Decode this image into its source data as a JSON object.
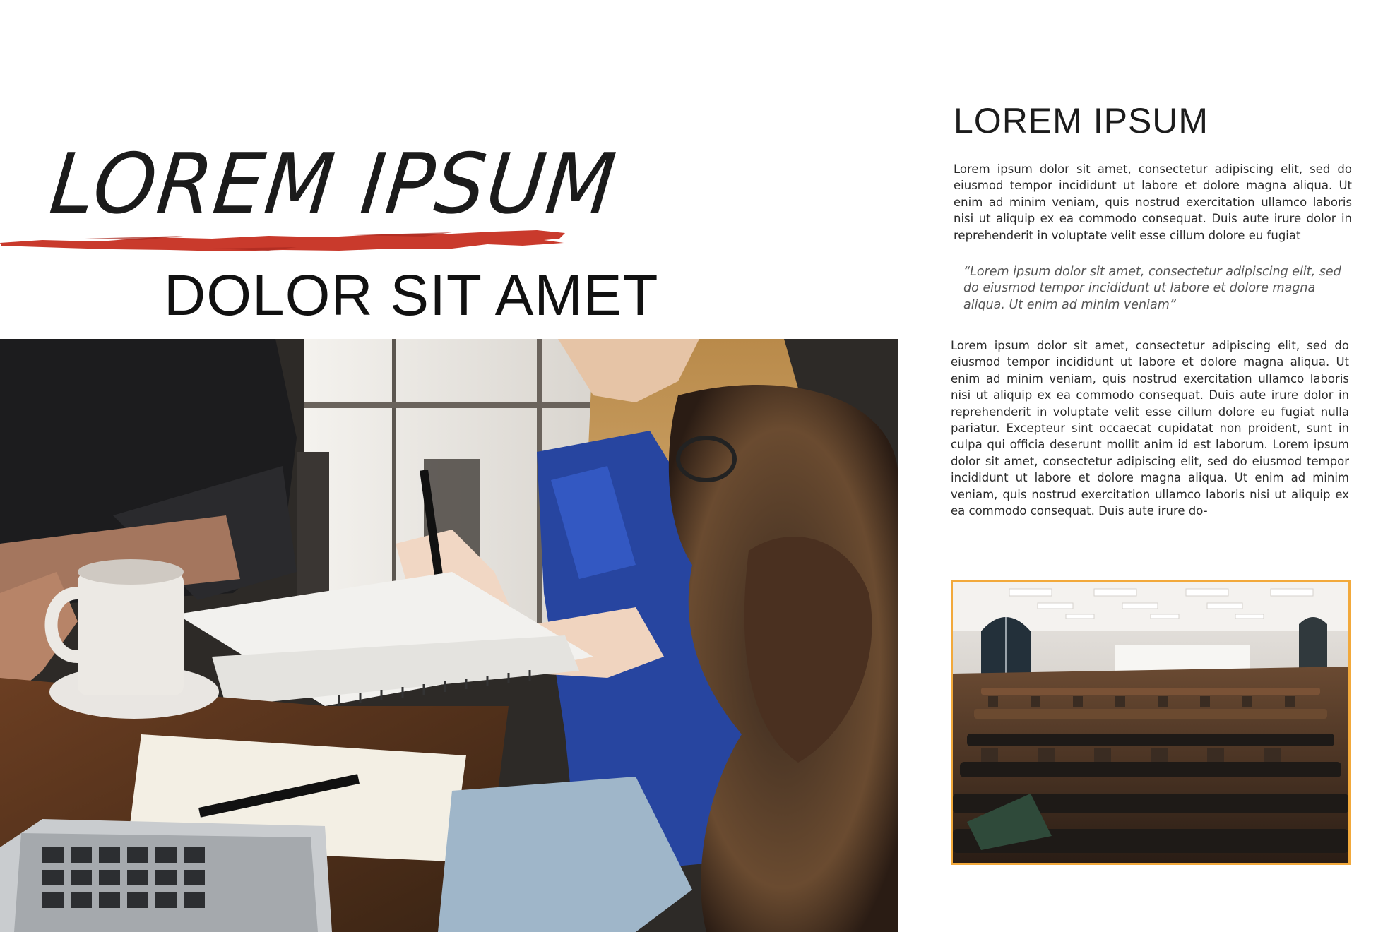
{
  "left_page": {
    "script_title": "LOREM IPSUM",
    "subtitle": "DOLOR SIT AMET",
    "accent_color": "#c93a2c",
    "photo_icon": "students-studying-photo"
  },
  "right_page": {
    "heading": "LOREM IPSUM",
    "paragraph_1": "Lorem ipsum dolor sit amet, consectetur adipiscing elit, sed do eiusmod tempor incididunt ut labore et dolore magna aliqua. Ut enim ad minim veniam, quis nostrud exercitation ullamco laboris nisi ut aliquip ex ea commodo consequat. Duis aute irure dolor in reprehenderit in voluptate velit esse cillum dolore eu fugiat",
    "quote": "“Lorem ipsum dolor sit amet, consectetur adipiscing elit, sed do eiusmod tempor incididunt ut labore et dolore magna aliqua. Ut enim ad minim veniam”",
    "paragraph_2": "Lorem ipsum dolor sit amet, consectetur adipiscing elit, sed do eiusmod tempor incididunt ut labore et dolore magna aliqua. Ut enim ad minim veniam, quis nostrud exercitation ullamco laboris nisi ut aliquip ex ea commodo consequat. Duis aute irure dolor in reprehenderit in voluptate velit esse cillum dolore eu fugiat nulla pariatur. Excepteur sint occaecat cupidatat non proident, sunt in culpa qui officia deserunt mollit anim id est laborum. Lorem ipsum dolor sit amet, consectetur adipiscing elit, sed do eiusmod tempor incididunt ut labore et dolore magna aliqua. Ut enim ad minim veniam, quis nostrud exercitation ullamco laboris nisi ut aliquip ex ea commodo consequat. Duis aute irure do-",
    "photo_frame_color": "#f2a93b",
    "photo_icon": "lecture-hall-photo"
  }
}
